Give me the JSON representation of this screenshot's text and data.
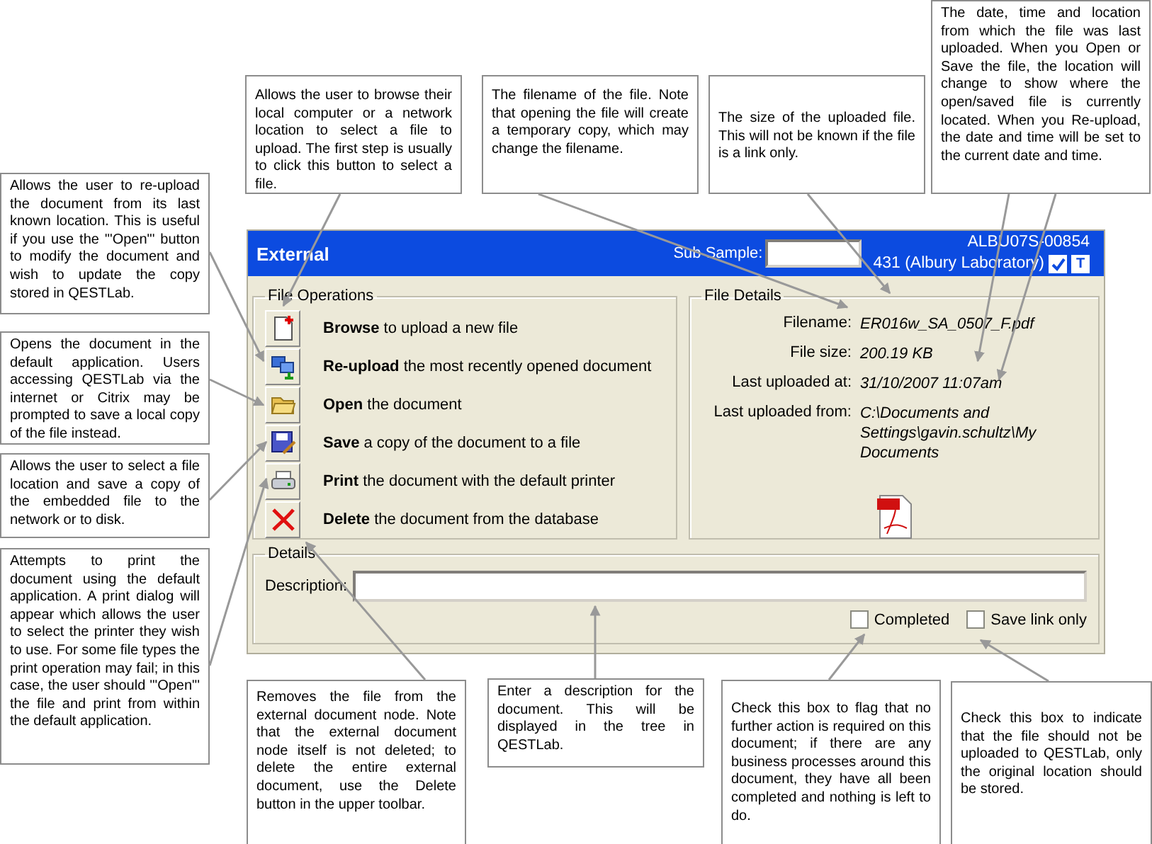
{
  "panel": {
    "title": "External",
    "sub_sample_label": "Sub Sample:",
    "sample_id": "ALBU07S-00854",
    "lab": "431 (Albury Laboratory)",
    "flags": [
      {
        "kind": "tick",
        "checked": true
      },
      {
        "kind": "letter",
        "text": "T"
      }
    ]
  },
  "file_operations": {
    "title": "File Operations",
    "operations": [
      {
        "kind": "browse",
        "action": "Browse",
        "rest": "to upload a new file"
      },
      {
        "kind": "reupload",
        "action": "Re-upload",
        "rest": "the most recently opened document"
      },
      {
        "kind": "open",
        "action": "Open",
        "rest": "the document"
      },
      {
        "kind": "save",
        "action": "Save",
        "rest": "a copy of the document to a file"
      },
      {
        "kind": "print",
        "action": "Print",
        "rest": "the document with the default printer"
      },
      {
        "kind": "delete",
        "action": "Delete",
        "rest": "the document from the database"
      }
    ]
  },
  "file_details": {
    "title": "File Details",
    "fields": [
      {
        "label": "Filename:",
        "value": "ER016w_SA_0507_F.pdf"
      },
      {
        "label": "File size:",
        "value": "200.19 KB"
      },
      {
        "label": "Last uploaded at:",
        "value": "31/10/2007 11:07am"
      },
      {
        "label": "Last uploaded from:",
        "value": "C:\\Documents and Settings\\gavin.schultz\\My Documents"
      }
    ]
  },
  "details": {
    "title": "Details",
    "description_label": "Description:",
    "checkboxes": [
      {
        "label": "Completed",
        "checked": false
      },
      {
        "label": "Save link only",
        "checked": false
      }
    ]
  },
  "callouts": [
    {
      "text": "Allows the user to browse their local computer or a network location to select a file to upload. The first step is usually to click this button to select a file."
    },
    {
      "text": "The filename of the file. Note that opening the file will create a temporary copy, which may change the filename."
    },
    {
      "text": "The size of the uploaded file. This will not be known if the file is a link only."
    },
    {
      "text": "The date, time and location from which the file was last uploaded. When you Open or Save the file, the location will change to show where the open/saved file is currently located. When you Re-upload, the date and time will be set to the current date and time."
    },
    {
      "text": "Allows the user to re-upload the document from its last known location. This is useful if you use the '\"Open\"' button to modify the document and wish to update the copy stored in QESTLab."
    },
    {
      "text": "Opens the document in the default application. Users accessing QESTLab via the internet or Citrix may be prompted to save a local copy of the file instead."
    },
    {
      "text": "Allows the user to select a file location and save a copy of the embedded file to the network or to disk."
    },
    {
      "text": "Attempts to print the document using the default application. A print dialog will appear which allows the user to select the printer they wish to use. For some file types the print operation may fail; in this case, the user should '\"Open\"' the file and print from within the default application."
    },
    {
      "text": "Removes the file from the external document node. Note that the external document node itself is not deleted; to delete the entire external document, use the Delete button in the upper toolbar."
    },
    {
      "text": "Enter a description for the document. This will be displayed in the tree in QESTLab."
    },
    {
      "text": "Check this box to flag that no further action is required on this document; if there are any business processes around this document, they have all been completed and nothing is left to do."
    },
    {
      "text": "Check this box to indicate that the file should not be uploaded to QESTLab, only the original location should be stored."
    }
  ]
}
